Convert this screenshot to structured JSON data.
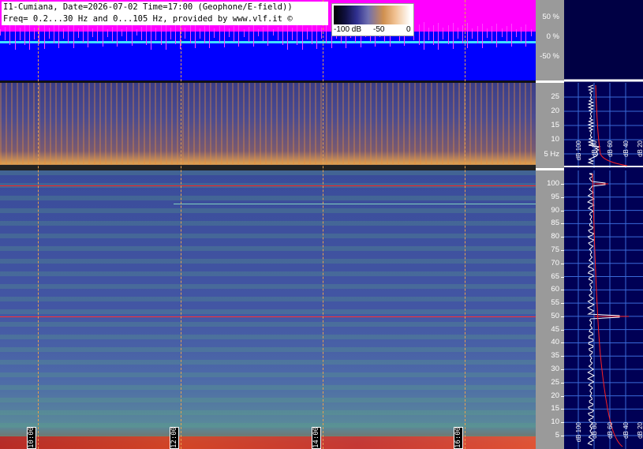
{
  "header": {
    "line1": "I1-Cumiana, Date=2026-07-02 Time=17:00 (Geophone/E-field))",
    "line2": "Freq= 0.2...30 Hz and 0...105 Hz, provided by www.vlf.it ©"
  },
  "colorbar": {
    "labels": [
      "-100 dB",
      "-50",
      "0"
    ]
  },
  "amplitude_scale": {
    "labels": [
      "50 %",
      "0 %",
      "-50 %"
    ]
  },
  "lf_scale": {
    "labels": [
      "25",
      "20",
      "15",
      "10",
      "5 Hz"
    ]
  },
  "main_scale": {
    "labels": [
      "100",
      "95",
      "90",
      "85",
      "80",
      "75",
      "70",
      "65",
      "60",
      "55",
      "50",
      "45",
      "40",
      "35",
      "30",
      "25",
      "20",
      "15",
      "10",
      "5"
    ]
  },
  "time_markers": [
    "10:00",
    "12:00",
    "14:00",
    "16:00"
  ],
  "right_panel": {
    "lf_labels": [
      "dB 100",
      "dB 80",
      "dB 60",
      "dB 40",
      "dB 20"
    ],
    "main_labels": [
      "dB 100",
      "dB 80",
      "dB 60",
      "dB 40",
      "dB 20"
    ]
  },
  "colors": {
    "amplitude_bg": "#0000ff",
    "amplitude_top": "#ff00ff",
    "trace": "#40e0ff",
    "grid": "#e8a050",
    "mains_line": "#ff2020"
  }
}
